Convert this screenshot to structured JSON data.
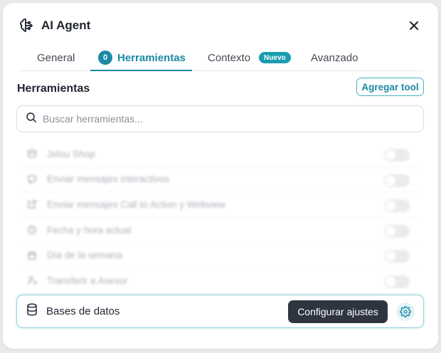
{
  "header": {
    "title": "AI Agent",
    "close_icon": "close-icon",
    "brand_icon": "brain-icon"
  },
  "tabs": [
    {
      "label": "General",
      "active": false
    },
    {
      "label": "Herramientas",
      "active": true,
      "count": "0"
    },
    {
      "label": "Contexto",
      "active": false,
      "badge": "Nuevo"
    },
    {
      "label": "Avanzado",
      "active": false
    }
  ],
  "section": {
    "title": "Herramientas",
    "add_label": "Agregar tool"
  },
  "search": {
    "placeholder": "Buscar herramientas...",
    "value": ""
  },
  "tools": [
    {
      "label": "Jelou Shop",
      "icon": "shop-icon",
      "enabled": false
    },
    {
      "label": "Enviar mensajes interactivos",
      "icon": "message-icon",
      "enabled": false
    },
    {
      "label": "Enviar mensajes Call to Action y Webview",
      "icon": "external-link-icon",
      "enabled": false
    },
    {
      "label": "Fecha y hora actual",
      "icon": "clock-icon",
      "enabled": false
    },
    {
      "label": "Día de la semana",
      "icon": "calendar-icon",
      "enabled": false
    },
    {
      "label": "Transferir a Asesor",
      "icon": "user-transfer-icon",
      "enabled": false
    }
  ],
  "active_tool": {
    "label": "Bases de datos",
    "icon": "database-icon",
    "config_label": "Configurar ajustes",
    "settings_icon": "gear-icon"
  },
  "colors": {
    "accent": "#1a8aa6",
    "dark_button": "#2f3441",
    "badge": "#1a9cb0"
  }
}
